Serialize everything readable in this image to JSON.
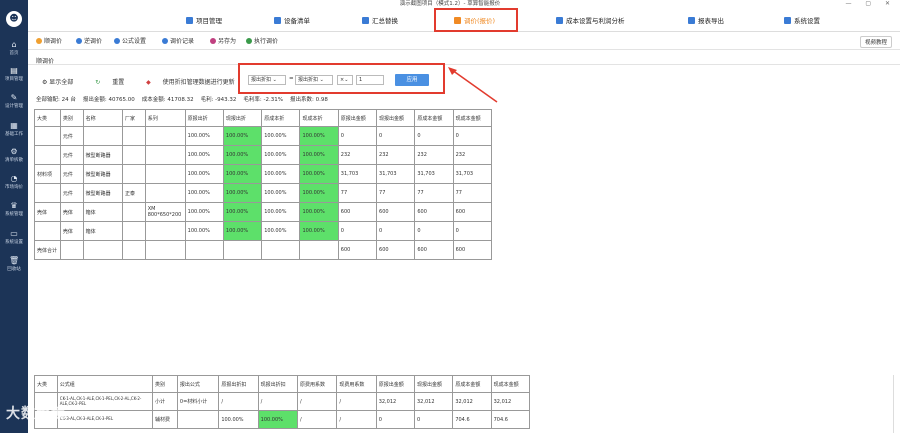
{
  "window": {
    "title": "演示截图项目（模式1.2）- 草算智能报价",
    "controls": "— ▢ ✕"
  },
  "sidebar": {
    "logo": "☻",
    "items": [
      {
        "label": "首页",
        "icon": "home-icon",
        "glyph": "⌂"
      },
      {
        "label": "项目管理",
        "icon": "document-icon",
        "glyph": "▤"
      },
      {
        "label": "设计管理",
        "icon": "design-icon",
        "glyph": "✎"
      },
      {
        "label": "基础工作",
        "icon": "clipboard-icon",
        "glyph": "▦"
      },
      {
        "label": "清单拆散",
        "icon": "network-icon",
        "glyph": "⚙"
      },
      {
        "label": "市场询价",
        "icon": "chart-icon",
        "glyph": "◔"
      },
      {
        "label": "系统管理",
        "icon": "crown-icon",
        "glyph": "♛"
      },
      {
        "label": "系统设置",
        "icon": "monitor-icon",
        "glyph": "▭"
      },
      {
        "label": "回收站",
        "icon": "trash-icon",
        "glyph": "🗑"
      }
    ]
  },
  "nav": {
    "tabs": [
      {
        "label": "项目管理",
        "color": "#3a7bd5"
      },
      {
        "label": "设备清单",
        "color": "#3a7bd5"
      },
      {
        "label": "汇总替换",
        "color": "#3a7bd5"
      },
      {
        "label": "调价(报价)",
        "color": "#f08a24"
      },
      {
        "label": "成本设置与利润分析",
        "color": "#3a7bd5"
      },
      {
        "label": "报表导出",
        "color": "#3a7bd5"
      },
      {
        "label": "系统设置",
        "color": "#3a7bd5"
      }
    ]
  },
  "toolbar": {
    "items": [
      {
        "label": "顺调价",
        "color": "#f0a030"
      },
      {
        "label": "逆调价",
        "color": "#3a7bd5"
      },
      {
        "label": "公式设置",
        "color": "#3a7bd5"
      },
      {
        "label": "调价记录",
        "color": "#3a7bd5"
      },
      {
        "label": "另存为",
        "color": "#c04080"
      },
      {
        "label": "执行调价",
        "color": "#3a9a4a"
      }
    ],
    "help": "视频教程"
  },
  "subtab": "顺调价",
  "options": {
    "show_all": "显示全部",
    "reset": "重置",
    "use_discount": "使用折扣管理数据进行更新"
  },
  "summary": [
    "全部输配: 24 台",
    "报出金额: 40765.00",
    "成本金额: 41708.32",
    "毛利: -943.32",
    "毛利率: -2.31%",
    "报出系数: 0.98"
  ],
  "panel": {
    "field1": "报出折扣",
    "op": "=",
    "field2": "报出折扣",
    "op2": "×",
    "value": "1",
    "apply": "应用"
  },
  "table1": {
    "headers": [
      "大类",
      "类别",
      "名称",
      "厂家",
      "系列",
      "原报出折",
      "现报出折",
      "原成本折",
      "现成本折",
      "原报出金额",
      "现报出金额",
      "原成本金额",
      "现成本金额"
    ],
    "rows": [
      {
        "cat": "",
        "sub": "元件",
        "name": "",
        "maker": "",
        "series": "",
        "c1": "100.00%",
        "c2": "100.00%",
        "c3": "100.00%",
        "c4": "100.00%",
        "v1": "0",
        "v2": "0",
        "v3": "0",
        "v4": "0"
      },
      {
        "cat": "",
        "sub": "元件",
        "name": "微型断路器",
        "maker": "",
        "series": "",
        "c1": "100.00%",
        "c2": "100.00%",
        "c3": "100.00%",
        "c4": "100.00%",
        "v1": "232",
        "v2": "232",
        "v3": "232",
        "v4": "232"
      },
      {
        "cat": "材料项",
        "sub": "元件",
        "name": "微型断路器",
        "maker": "",
        "series": "",
        "c1": "100.00%",
        "c2": "100.00%",
        "c3": "100.00%",
        "c4": "100.00%",
        "v1": "31,703",
        "v2": "31,703",
        "v3": "31,703",
        "v4": "31,703"
      },
      {
        "cat": "",
        "sub": "元件",
        "name": "微型断路器",
        "maker": "正泰",
        "series": "",
        "c1": "100.00%",
        "c2": "100.00%",
        "c3": "100.00%",
        "c4": "100.00%",
        "v1": "77",
        "v2": "77",
        "v3": "77",
        "v4": "77"
      },
      {
        "cat": "壳体",
        "sub": "壳体",
        "name": "箱体",
        "maker": "",
        "series": "XM 800*650*200",
        "c1": "100.00%",
        "c2": "100.00%",
        "c3": "100.00%",
        "c4": "100.00%",
        "v1": "600",
        "v2": "600",
        "v3": "600",
        "v4": "600"
      },
      {
        "cat": "",
        "sub": "壳体",
        "name": "箱体",
        "maker": "",
        "series": "",
        "c1": "100.00%",
        "c2": "100.00%",
        "c3": "100.00%",
        "c4": "100.00%",
        "v1": "0",
        "v2": "0",
        "v3": "0",
        "v4": "0"
      },
      {
        "cat": "壳体合计",
        "sub": "",
        "name": "",
        "maker": "",
        "series": "",
        "c1": "",
        "c2": "",
        "c3": "",
        "c4": "",
        "v1": "600",
        "v2": "600",
        "v3": "600",
        "v4": "600"
      }
    ]
  },
  "table2": {
    "headers": [
      "大类",
      "公式组",
      "类别",
      "报出公式",
      "原报出折扣",
      "现报出折扣",
      "原费用系数",
      "现费用系数",
      "原报出金额",
      "现报出金额",
      "原成本金额",
      "现成本金额"
    ],
    "rows": [
      {
        "c0": "",
        "c1": "CK-1-AL,CK-1-ALE,CK-1-PEL,CK-2-AL,CK-2-ALE,CK-2-PEL",
        "c2": "小计",
        "c3": "0=材料小计",
        "c4": "/",
        "c5": "/",
        "c6": "/",
        "c7": "/",
        "c8": "32,012",
        "c9": "32,012",
        "c10": "32,012",
        "c11": "32,012"
      },
      {
        "c0": "",
        "c1": "CK-3-AL,CK-3-ALE,CK-3-PEL",
        "c2": "辅材费",
        "c3": "",
        "c4": "100.00%",
        "c5": "100.00%",
        "c6": "/",
        "c7": "/",
        "c8": "0",
        "c9": "0",
        "c10": "704.6",
        "c11": "704.6"
      }
    ]
  },
  "watermark": "大数跨境"
}
